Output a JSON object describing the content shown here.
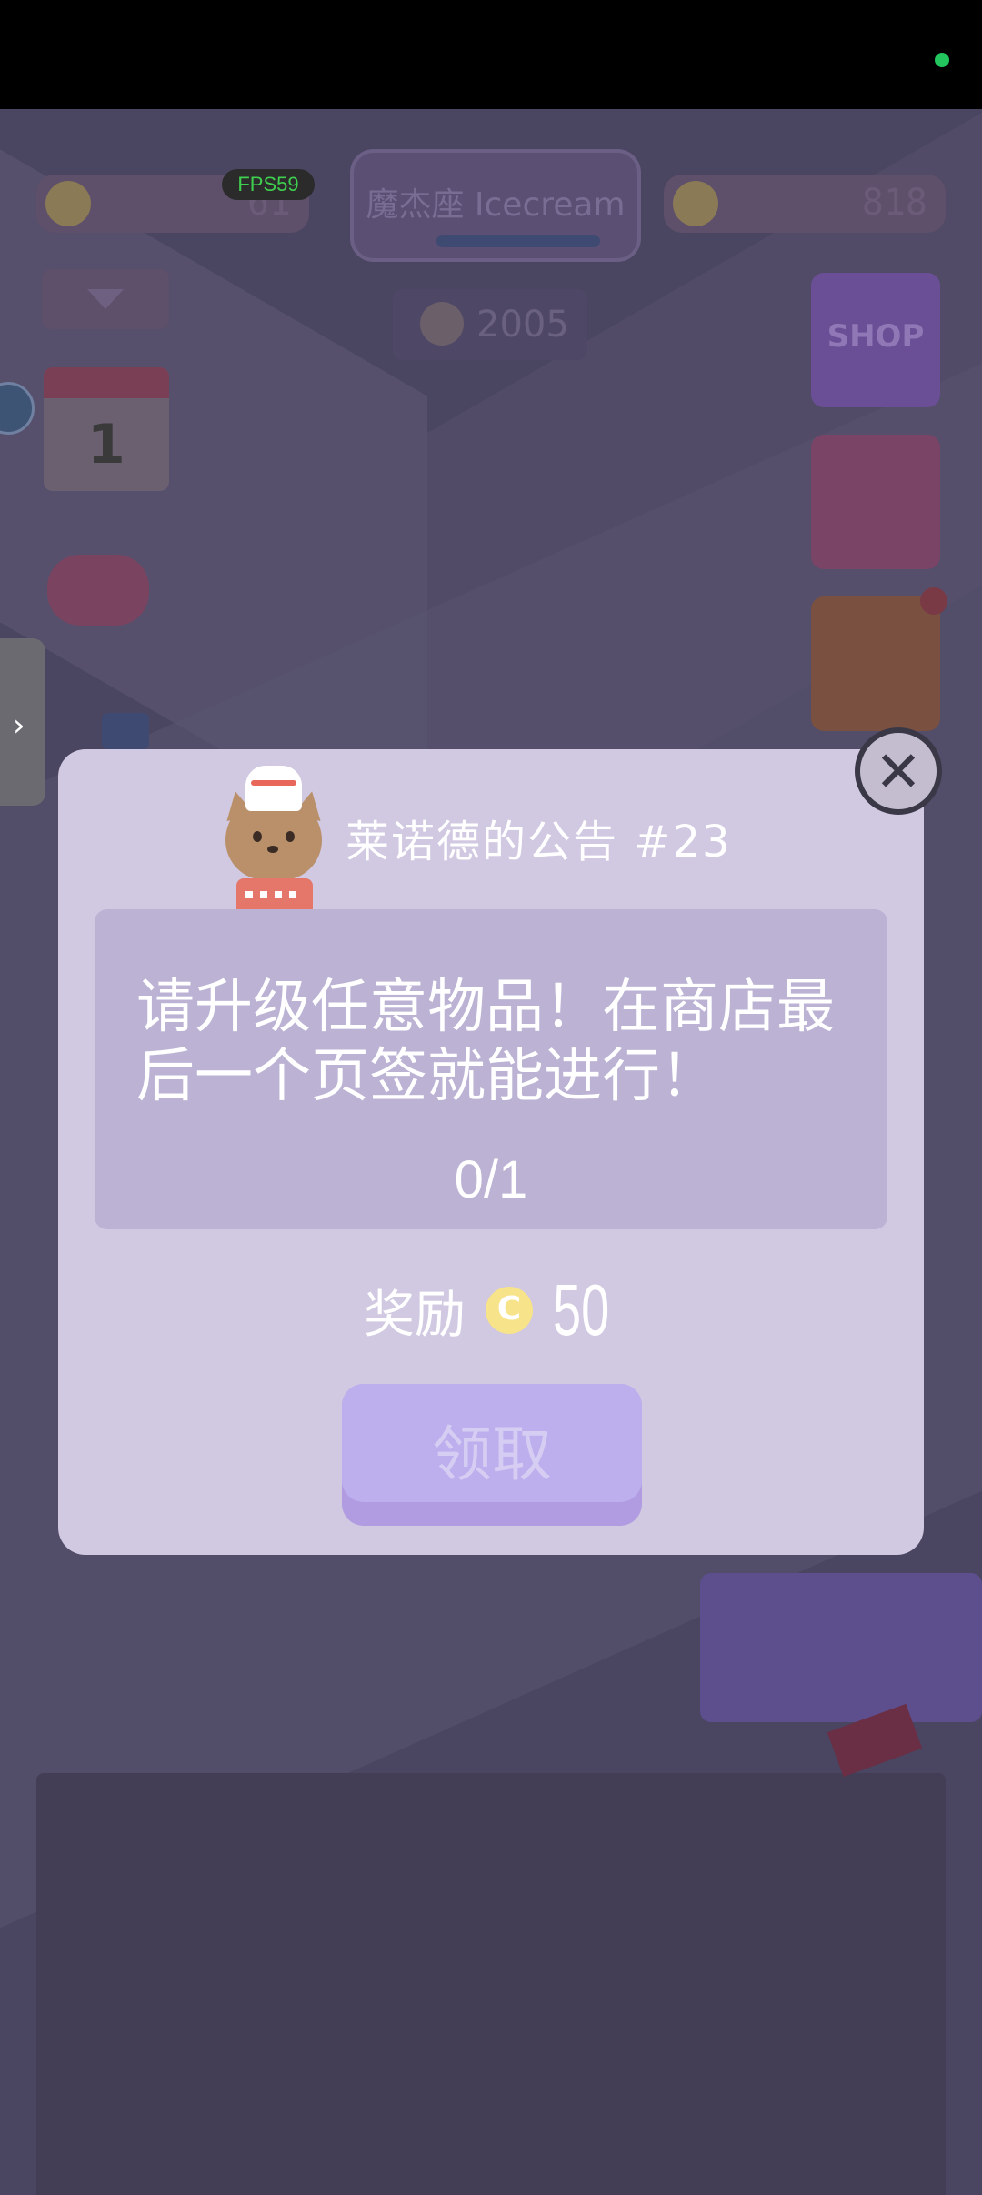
{
  "status_bar": {
    "indicator_color": "#22c55e"
  },
  "hud": {
    "fps": "FPS59",
    "coins_value": "61",
    "money_value": "818",
    "shop_title": "魔杰座 Icecream",
    "score": "2005",
    "shop_label": "SHOP",
    "calendar_day": "1"
  },
  "notice": {
    "title": "莱诺德的公告 #23",
    "task": "请升级任意物品！在商店最后一个页签就能进行！",
    "progress": "0/1",
    "reward_label": "奖励",
    "reward_coin_icon": "C",
    "reward_amount": "50",
    "claim_label": "领取",
    "close_icon": "✕"
  },
  "side_tab": {
    "icon": "›"
  },
  "colors": {
    "modal_bg": "#d1c8e1",
    "task_box": "#bbb2d4",
    "claim_button": "#bdaeee",
    "coin": "#f6e38a"
  }
}
